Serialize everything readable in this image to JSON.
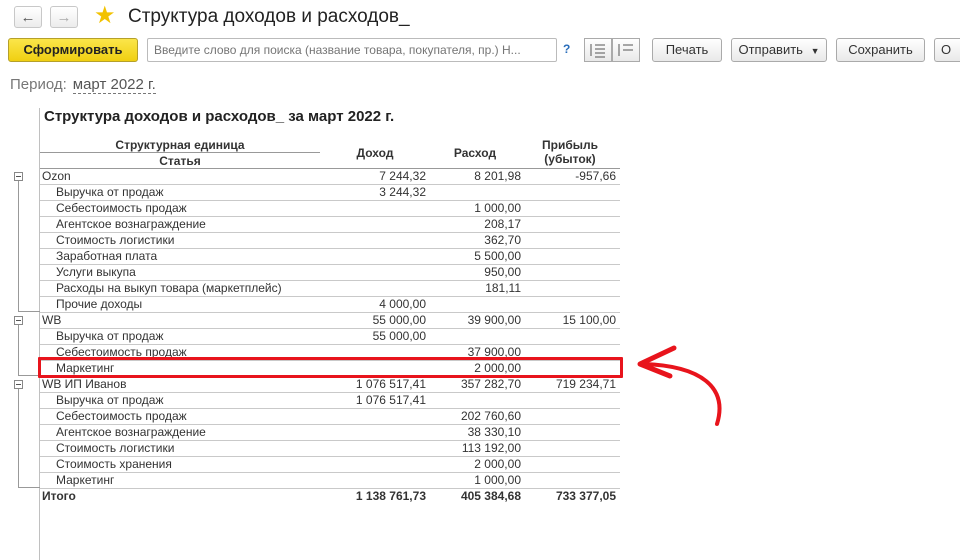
{
  "window": {
    "back_icon": "arrow-left-icon",
    "forward_icon": "arrow-right-icon",
    "title": "Структура доходов и расходов_"
  },
  "toolbar": {
    "generate_label": "Сформировать",
    "search_placeholder": "Введите слово для поиска (название товара, покупателя, пр.) Н...",
    "help_label": "?",
    "print_label": "Печать",
    "send_label": "Отправить",
    "save_label": "Сохранить",
    "more_label": "О"
  },
  "period": {
    "label": "Период:",
    "value": "март 2022 г."
  },
  "report": {
    "title": "Структура доходов и расходов_ за март 2022 г.",
    "headers": {
      "unit": "Структурная единица",
      "article": "Статья",
      "income": "Доход",
      "expense": "Расход",
      "profit_line1": "Прибыль",
      "profit_line2": "(убыток)"
    },
    "rows": [
      {
        "kind": "group",
        "name": "Ozon",
        "income": "7 244,32",
        "expense": "8 201,98",
        "profit": "-957,66"
      },
      {
        "kind": "item",
        "name": "Выручка от продаж",
        "income": "3 244,32",
        "expense": "",
        "profit": ""
      },
      {
        "kind": "item",
        "name": "Себестоимость продаж",
        "income": "",
        "expense": "1 000,00",
        "profit": ""
      },
      {
        "kind": "item",
        "name": "Агентское вознаграждение",
        "income": "",
        "expense": "208,17",
        "profit": ""
      },
      {
        "kind": "item",
        "name": "Стоимость логистики",
        "income": "",
        "expense": "362,70",
        "profit": ""
      },
      {
        "kind": "item",
        "name": "Заработная плата",
        "income": "",
        "expense": "5 500,00",
        "profit": ""
      },
      {
        "kind": "item",
        "name": "Услуги выкупа",
        "income": "",
        "expense": "950,00",
        "profit": ""
      },
      {
        "kind": "item",
        "name": "Расходы на выкуп товара (маркетплейс)",
        "income": "",
        "expense": "181,11",
        "profit": ""
      },
      {
        "kind": "item",
        "name": "Прочие доходы",
        "income": "4 000,00",
        "expense": "",
        "profit": ""
      },
      {
        "kind": "group",
        "name": "WB",
        "income": "55 000,00",
        "expense": "39 900,00",
        "profit": "15 100,00"
      },
      {
        "kind": "item",
        "name": "Выручка от продаж",
        "income": "55 000,00",
        "expense": "",
        "profit": ""
      },
      {
        "kind": "item",
        "name": "Себестоимость продаж",
        "income": "",
        "expense": "37 900,00",
        "profit": ""
      },
      {
        "kind": "item",
        "name": "Маркетинг",
        "income": "",
        "expense": "2 000,00",
        "profit": ""
      },
      {
        "kind": "group",
        "name": "WB ИП Иванов",
        "income": "1 076 517,41",
        "expense": "357 282,70",
        "profit": "719 234,71"
      },
      {
        "kind": "item",
        "name": "Выручка от продаж",
        "income": "1 076 517,41",
        "expense": "",
        "profit": ""
      },
      {
        "kind": "item",
        "name": "Себестоимость продаж",
        "income": "",
        "expense": "202 760,60",
        "profit": ""
      },
      {
        "kind": "item",
        "name": "Агентское вознаграждение",
        "income": "",
        "expense": "38 330,10",
        "profit": ""
      },
      {
        "kind": "item",
        "name": "Стоимость логистики",
        "income": "",
        "expense": "113 192,00",
        "profit": ""
      },
      {
        "kind": "item",
        "name": "Стоимость хранения",
        "income": "",
        "expense": "2 000,00",
        "profit": ""
      },
      {
        "kind": "item",
        "name": "Маркетинг",
        "income": "",
        "expense": "1 000,00",
        "profit": ""
      }
    ],
    "total": {
      "name": "Итого",
      "income": "1 138 761,73",
      "expense": "405 384,68",
      "profit": "733 377,05"
    }
  },
  "annotation": {
    "highlight_color": "#e8141c"
  }
}
